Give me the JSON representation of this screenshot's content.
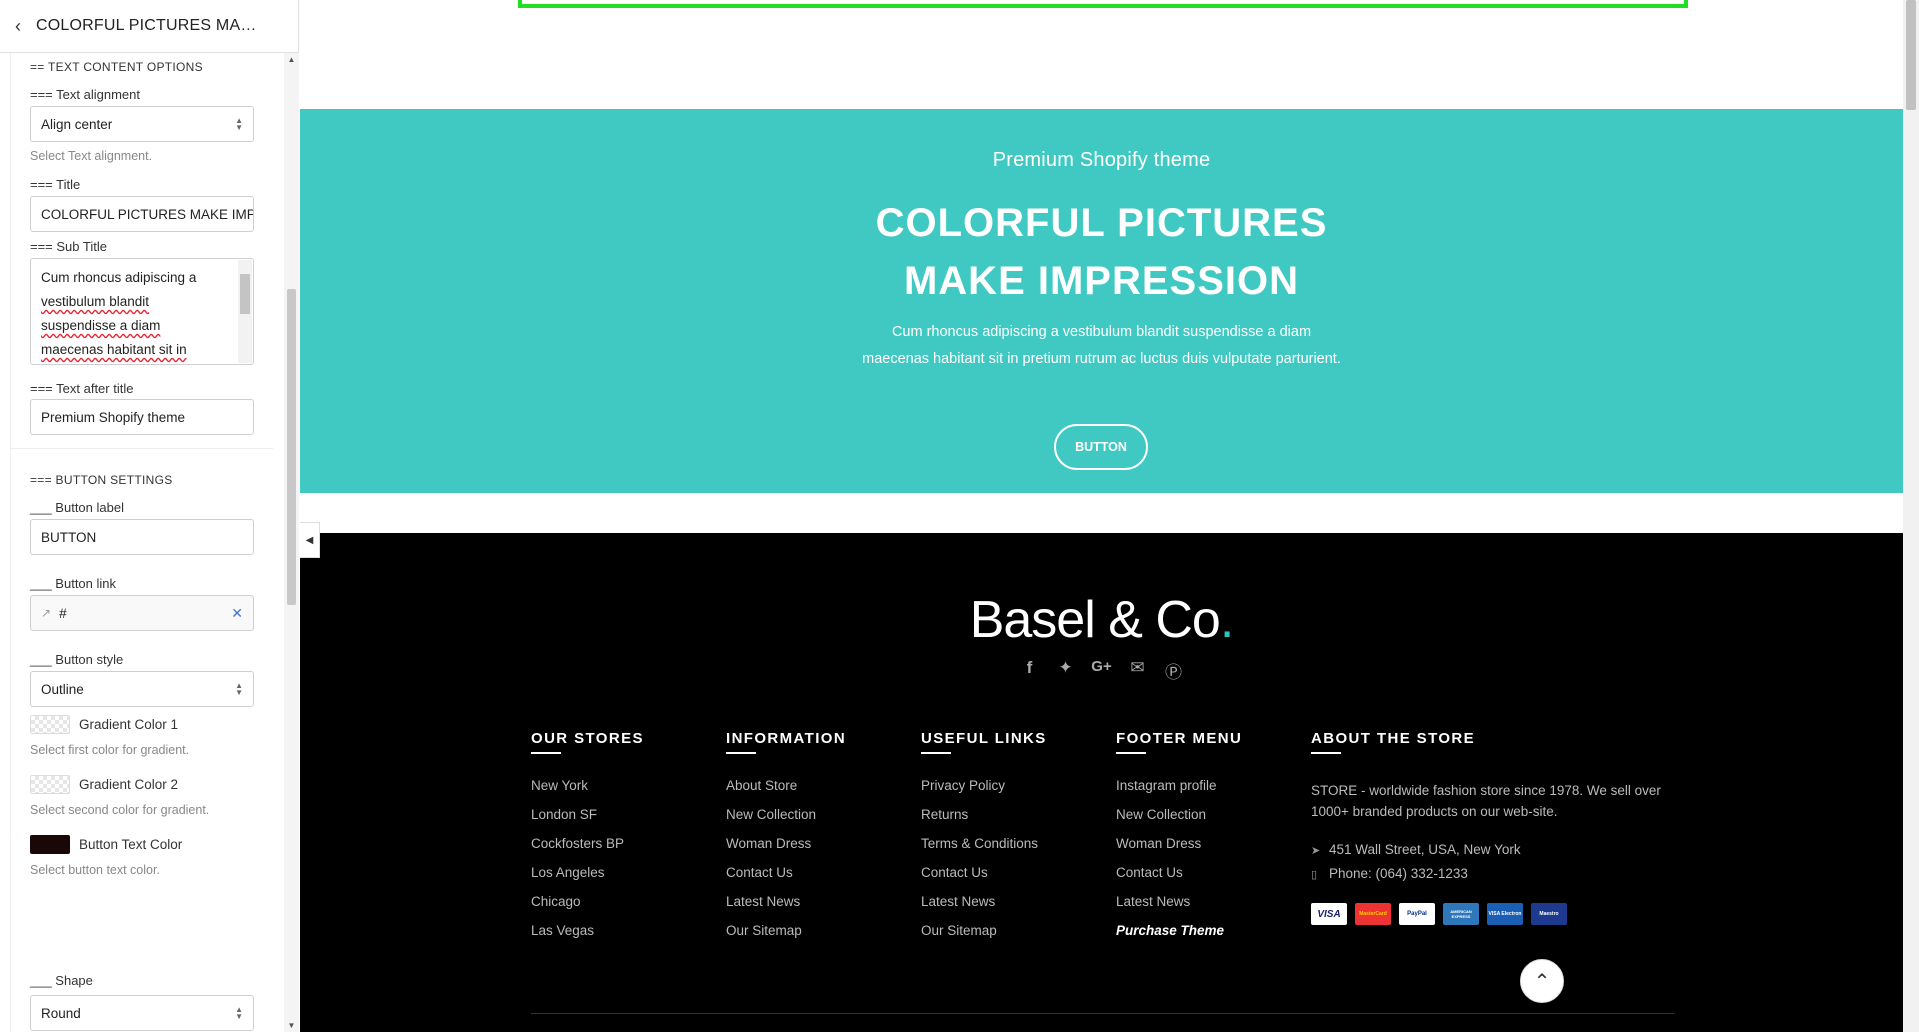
{
  "panel": {
    "title": "COLORFUL PICTURES MAKE ...",
    "text_content_section": "== TEXT CONTENT OPTIONS",
    "text_alignment_label": "=== Text alignment",
    "text_alignment_value": "Align center",
    "text_alignment_hint": "Select Text alignment.",
    "title_label": "=== Title",
    "title_value": "COLORFUL PICTURES MAKE IMP",
    "subtitle_label": "=== Sub Title",
    "subtitle_lines": [
      "Cum rhoncus adipiscing a",
      "vestibulum blandit",
      "suspendisse a diam",
      "maecenas habitant sit in"
    ],
    "text_after_title_label": "=== Text after title",
    "text_after_title_value": "Premium Shopify theme",
    "button_section": "=== BUTTON SETTINGS",
    "button_label_label": "___ Button label",
    "button_label_value": "BUTTON",
    "button_link_label": "___ Button link",
    "button_link_value": "#",
    "button_style_label": "___ Button style",
    "button_style_value": "Outline",
    "gradient1_label": "Gradient Color 1",
    "gradient1_hint": "Select first color for gradient.",
    "gradient2_label": "Gradient Color 2",
    "gradient2_hint": "Select second color for gradient.",
    "button_text_color_label": "Button Text Color",
    "button_text_color_hint": "Select button text color.",
    "button_text_color": "#1a0808",
    "shape_label": "___ Shape",
    "shape_value": "Round"
  },
  "banner": {
    "pre_title": "Premium Shopify theme",
    "title_line1": "COLORFUL PICTURES",
    "title_line2": "MAKE IMPRESSION",
    "subtitle": "Cum rhoncus adipiscing a vestibulum blandit suspendisse a diam maecenas habitant sit in pretium rutrum ac luctus duis vulputate parturient.",
    "button": "BUTTON",
    "bg_color": "#40c9c2"
  },
  "footer": {
    "logo_text": "Basel & Co",
    "logo_dot": ".",
    "socials": [
      "facebook-icon",
      "twitter-icon",
      "google-plus-icon",
      "email-icon",
      "pinterest-icon"
    ],
    "columns": [
      {
        "title": "OUR STORES",
        "links": [
          "New York",
          "London SF",
          "Cockfosters BP",
          "Los Angeles",
          "Chicago",
          "Las Vegas"
        ]
      },
      {
        "title": "INFORMATION",
        "links": [
          "About Store",
          "New Collection",
          "Woman Dress",
          "Contact Us",
          "Latest News",
          "Our Sitemap"
        ]
      },
      {
        "title": "USEFUL LINKS",
        "links": [
          "Privacy Policy",
          "Returns",
          "Terms & Conditions",
          "Contact Us",
          "Latest News",
          "Our Sitemap"
        ]
      },
      {
        "title": "FOOTER MENU",
        "links": [
          "Instagram profile",
          "New Collection",
          "Woman Dress",
          "Contact Us",
          "Latest News",
          "Purchase Theme"
        ]
      }
    ],
    "about": {
      "title": "ABOUT THE STORE",
      "text": "STORE - worldwide fashion store since 1978. We sell over 1000+ branded products on our web-site.",
      "address": "451 Wall Street, USA, New York",
      "phone": "Phone: (064) 332-1233",
      "cards": [
        "VISA",
        "MasterCard",
        "PayPal",
        "AMERICAN EXPRESS",
        "VISA Electron",
        "Maestro"
      ]
    }
  }
}
